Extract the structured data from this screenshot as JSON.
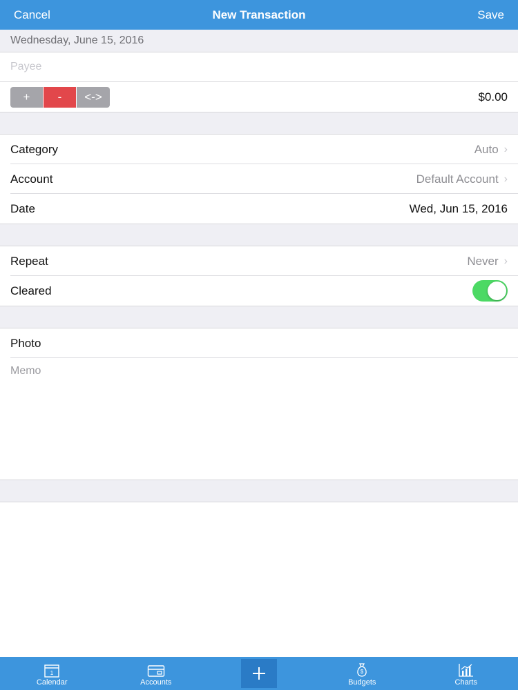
{
  "navbar": {
    "cancel_label": "Cancel",
    "title": "New Transaction",
    "save_label": "Save"
  },
  "date_header": "Wednesday, June 15, 2016",
  "payee": {
    "placeholder": "Payee",
    "value": ""
  },
  "type_selector": {
    "options": [
      "+",
      "-",
      "<->"
    ],
    "selected": "-"
  },
  "amount": "$0.00",
  "rows": {
    "category": {
      "label": "Category",
      "value": "Auto"
    },
    "account": {
      "label": "Account",
      "value": "Default Account"
    },
    "date": {
      "label": "Date",
      "value": "Wed, Jun 15, 2016"
    },
    "repeat": {
      "label": "Repeat",
      "value": "Never"
    },
    "cleared": {
      "label": "Cleared",
      "on": true
    },
    "photo": {
      "label": "Photo"
    }
  },
  "memo": {
    "placeholder": "Memo",
    "value": ""
  },
  "tabbar": {
    "calendar": {
      "label": "Calendar",
      "icon": "calendar-icon"
    },
    "accounts": {
      "label": "Accounts",
      "icon": "card-icon"
    },
    "add": {
      "icon": "plus-icon"
    },
    "budgets": {
      "label": "Budgets",
      "icon": "money-bag-icon"
    },
    "charts": {
      "label": "Charts",
      "icon": "chart-icon"
    }
  },
  "colors": {
    "accent": "#3d95dd",
    "selected_segment": "#e2474b",
    "toggle_on": "#4cd964"
  }
}
